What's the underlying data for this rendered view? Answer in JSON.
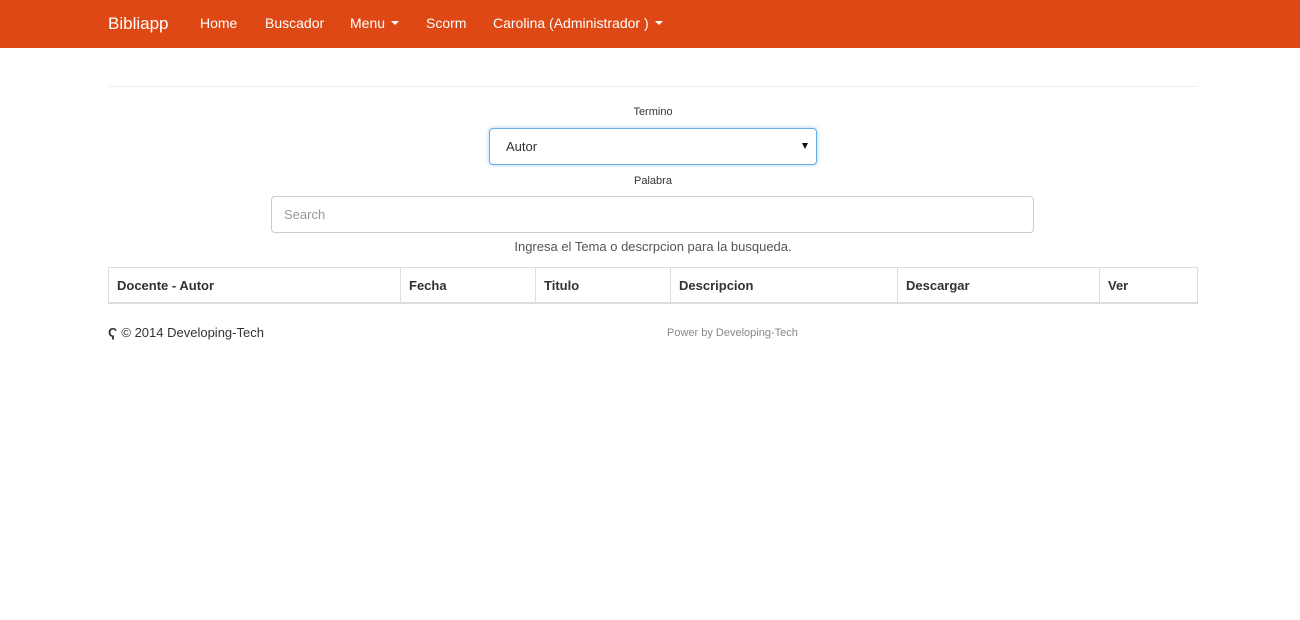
{
  "navbar": {
    "brand": "Bibliapp",
    "items": [
      {
        "label": "Home"
      },
      {
        "label": "Buscador"
      },
      {
        "label": "Menu"
      },
      {
        "label": "Scorm"
      },
      {
        "label": "Carolina (Administrador )"
      }
    ],
    "color": "#dd4814"
  },
  "form": {
    "termino_label": "Termino",
    "termino_value": "Autor",
    "palabra_label": "Palabra",
    "search_placeholder": "Search",
    "help_text": "Ingresa el Tema o descrpcion para la busqueda."
  },
  "table": {
    "columns": [
      "Docente - Autor",
      "Fecha",
      "Titulo",
      "Descripcion",
      "Descargar",
      "Ver"
    ]
  },
  "footer": {
    "logo_icon": "Ҁ",
    "copyright": "© 2014 Developing-Tech",
    "power": "Power by Developing-Tech"
  }
}
